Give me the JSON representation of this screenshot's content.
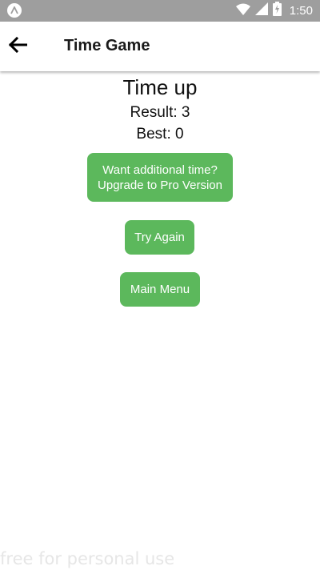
{
  "status_bar": {
    "time": "1:50",
    "app_icon": "android-notification-icon",
    "icons": [
      "wifi-icon",
      "signal-icon",
      "battery-charging-icon"
    ],
    "color": "#9e9e9e"
  },
  "app_bar": {
    "back_icon": "arrow-left-icon",
    "title": "Time Game"
  },
  "main": {
    "headline": "Time up",
    "result": "Result: 3",
    "best": "Best: 0",
    "buttons": {
      "upgrade_line1": "Want additional time?",
      "upgrade_line2": "Upgrade to Pro Version",
      "try_again": "Try Again",
      "main_menu": "Main Menu"
    },
    "accent_color": "#5cb85c"
  },
  "watermark": "free for personal use"
}
